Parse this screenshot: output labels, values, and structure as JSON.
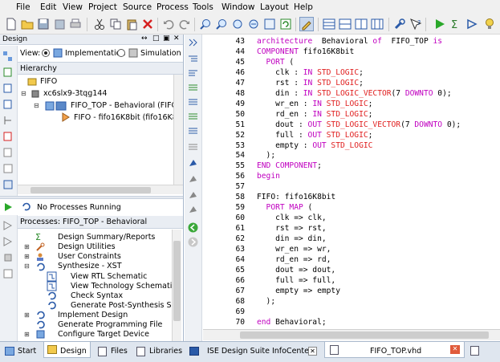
{
  "menubar": {
    "items": [
      "File",
      "Edit",
      "View",
      "Project",
      "Source",
      "Process",
      "Tools",
      "Window",
      "Layout",
      "Help"
    ]
  },
  "design_panel": {
    "title": "Design",
    "view_label": "View:",
    "view_options": [
      "Implementation",
      "Simulation"
    ],
    "view_selected": "Implementation",
    "hierarchy_label": "Hierarchy",
    "tree": [
      {
        "label": "FIFO",
        "level": 0
      },
      {
        "label": "xc6slx9-3tqg144",
        "level": 0
      },
      {
        "label": "FIFO_TOP - Behavioral (FIFO_TO",
        "level": 1
      },
      {
        "label": "FIFO - fifo16K8bit (fifo16K8bit.x",
        "level": 2
      }
    ]
  },
  "process_panel": {
    "status": "No Processes Running",
    "title": "Processes: FIFO_TOP - Behavioral",
    "items": [
      {
        "label": "Design Summary/Reports",
        "level": 1
      },
      {
        "label": "Design Utilities",
        "level": 1
      },
      {
        "label": "User Constraints",
        "level": 1
      },
      {
        "label": "Synthesize - XST",
        "level": 1
      },
      {
        "label": "View RTL Schematic",
        "level": 2
      },
      {
        "label": "View Technology Schematic",
        "level": 2
      },
      {
        "label": "Check Syntax",
        "level": 2
      },
      {
        "label": "Generate Post-Synthesis Si...",
        "level": 2
      },
      {
        "label": "Implement Design",
        "level": 1
      },
      {
        "label": "Generate Programming File",
        "level": 1
      },
      {
        "label": "Configure Target Device",
        "level": 1
      }
    ]
  },
  "editor": {
    "lines": [
      {
        "n": "43",
        "segs": [
          [
            "kw",
            "architecture"
          ],
          [
            "",
            "  Behavioral "
          ],
          [
            "kw",
            "of"
          ],
          [
            "",
            "  FIFO_TOP "
          ],
          [
            "kw",
            "is"
          ]
        ]
      },
      {
        "n": "44",
        "segs": [
          [
            "kw",
            "COMPONENT"
          ],
          [
            "",
            " fifo16K8bit"
          ]
        ]
      },
      {
        "n": "45",
        "segs": [
          [
            "kw",
            "  PORT"
          ],
          [
            "",
            " ("
          ]
        ]
      },
      {
        "n": "46",
        "segs": [
          [
            "",
            "    clk : "
          ],
          [
            "kw",
            "IN"
          ],
          [
            "",
            " "
          ],
          [
            "ty",
            "STD_LOGIC"
          ],
          [
            "",
            ";"
          ]
        ]
      },
      {
        "n": "47",
        "segs": [
          [
            "",
            "    rst : "
          ],
          [
            "kw",
            "IN"
          ],
          [
            "",
            " "
          ],
          [
            "ty",
            "STD_LOGIC"
          ],
          [
            "",
            ";"
          ]
        ]
      },
      {
        "n": "48",
        "segs": [
          [
            "",
            "    din : "
          ],
          [
            "kw",
            "IN"
          ],
          [
            "",
            " "
          ],
          [
            "ty",
            "STD_LOGIC_VECTOR"
          ],
          [
            "",
            "(7 "
          ],
          [
            "kw",
            "DOWNTO"
          ],
          [
            "",
            " 0);"
          ]
        ]
      },
      {
        "n": "49",
        "segs": [
          [
            "",
            "    wr_en : "
          ],
          [
            "kw",
            "IN"
          ],
          [
            "",
            " "
          ],
          [
            "ty",
            "STD_LOGIC"
          ],
          [
            "",
            ";"
          ]
        ]
      },
      {
        "n": "50",
        "segs": [
          [
            "",
            "    rd_en : "
          ],
          [
            "kw",
            "IN"
          ],
          [
            "",
            " "
          ],
          [
            "ty",
            "STD_LOGIC"
          ],
          [
            "",
            ";"
          ]
        ]
      },
      {
        "n": "51",
        "segs": [
          [
            "",
            "    dout : "
          ],
          [
            "kw",
            "OUT"
          ],
          [
            "",
            " "
          ],
          [
            "ty",
            "STD_LOGIC_VECTOR"
          ],
          [
            "",
            "(7 "
          ],
          [
            "kw",
            "DOWNTO"
          ],
          [
            "",
            " 0);"
          ]
        ]
      },
      {
        "n": "52",
        "segs": [
          [
            "",
            "    full : "
          ],
          [
            "kw",
            "OUT"
          ],
          [
            "",
            " "
          ],
          [
            "ty",
            "STD_LOGIC"
          ],
          [
            "",
            ";"
          ]
        ]
      },
      {
        "n": "53",
        "segs": [
          [
            "",
            "    empty : "
          ],
          [
            "kw",
            "OUT"
          ],
          [
            "",
            " "
          ],
          [
            "ty",
            "STD_LOGIC"
          ]
        ]
      },
      {
        "n": "54",
        "segs": [
          [
            "",
            "  );"
          ]
        ]
      },
      {
        "n": "55",
        "segs": [
          [
            "kw",
            "END COMPONENT"
          ],
          [
            "",
            ";"
          ]
        ]
      },
      {
        "n": "56",
        "segs": [
          [
            "kw",
            "begin"
          ]
        ]
      },
      {
        "n": "57",
        "segs": [
          [
            "",
            ""
          ]
        ]
      },
      {
        "n": "58",
        "segs": [
          [
            "",
            "FIFO: fifo16K8bit"
          ]
        ]
      },
      {
        "n": "59",
        "segs": [
          [
            "kw",
            "  PORT MAP"
          ],
          [
            "",
            " ("
          ]
        ]
      },
      {
        "n": "60",
        "segs": [
          [
            "",
            "    clk => clk,"
          ]
        ]
      },
      {
        "n": "61",
        "segs": [
          [
            "",
            "    rst => rst,"
          ]
        ]
      },
      {
        "n": "62",
        "segs": [
          [
            "",
            "    din => din,"
          ]
        ]
      },
      {
        "n": "63",
        "segs": [
          [
            "",
            "    wr_en => wr,"
          ]
        ]
      },
      {
        "n": "64",
        "segs": [
          [
            "",
            "    rd_en => rd,"
          ]
        ]
      },
      {
        "n": "65",
        "segs": [
          [
            "",
            "    dout => dout,"
          ]
        ]
      },
      {
        "n": "66",
        "segs": [
          [
            "",
            "    full => full,"
          ]
        ]
      },
      {
        "n": "67",
        "segs": [
          [
            "",
            "    empty => empty"
          ]
        ]
      },
      {
        "n": "68",
        "segs": [
          [
            "",
            "  );"
          ]
        ]
      },
      {
        "n": "69",
        "segs": [
          [
            "",
            ""
          ]
        ]
      },
      {
        "n": "70",
        "segs": [
          [
            "kw",
            "end"
          ],
          [
            "",
            " Behavioral;"
          ]
        ]
      }
    ]
  },
  "bottom_tabs": {
    "left": [
      "Start",
      "Design",
      "Files",
      "Libraries"
    ],
    "left_selected": "Design",
    "right": [
      "ISE Design Suite InfoCenter",
      "FIFO_TOP.vhd"
    ],
    "right_selected": "FIFO_TOP.vhd"
  },
  "colors": {
    "keyword": "#c000c0",
    "type": "#e02020",
    "panel_bg": "#e9edf3"
  }
}
